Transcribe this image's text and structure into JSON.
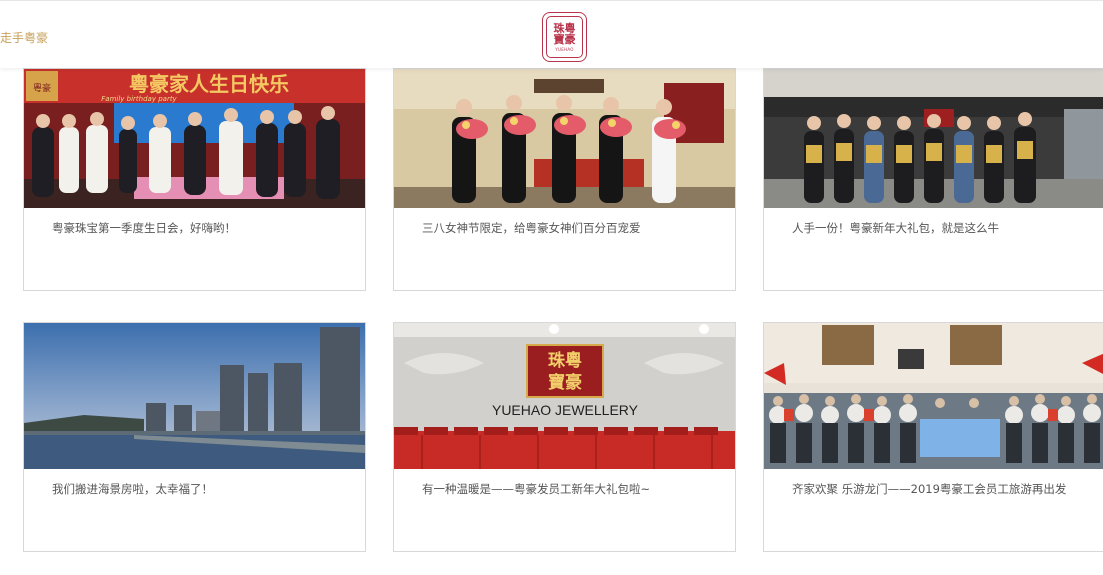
{
  "header": {
    "nav_link": "走手粤豪",
    "logo": {
      "line1": "珠粵",
      "line2": "寶豪",
      "en": "YUEHAO"
    }
  },
  "colors": {
    "brand_red": "#b8344a",
    "gold": "#c6a05a",
    "caption_text": "#555555",
    "card_border": "#d8d8d8"
  },
  "cards": [
    {
      "caption": "粤豪珠宝第一季度生日会，好嗨哟！",
      "photo_banner": "粵豪家人生日快乐",
      "photo_banner_sub": "Family birthday party",
      "photo_sign": "粵豪"
    },
    {
      "caption": "三八女神节限定，给粤豪女神们百分百宠爱"
    },
    {
      "caption": "人手一份！粤豪新年大礼包，就是这么牛"
    },
    {
      "caption": "我们搬进海景房啦，太幸福了！"
    },
    {
      "caption": "有一种温暖是——粤豪发员工新年大礼包啦~",
      "photo_sign_line1": "珠粵",
      "photo_sign_line2": "寶豪",
      "photo_brand": "YUEHAO JEWELLERY"
    },
    {
      "caption": "齐家欢聚 乐游龙门——2019粤豪工会员工旅游再出发"
    }
  ]
}
